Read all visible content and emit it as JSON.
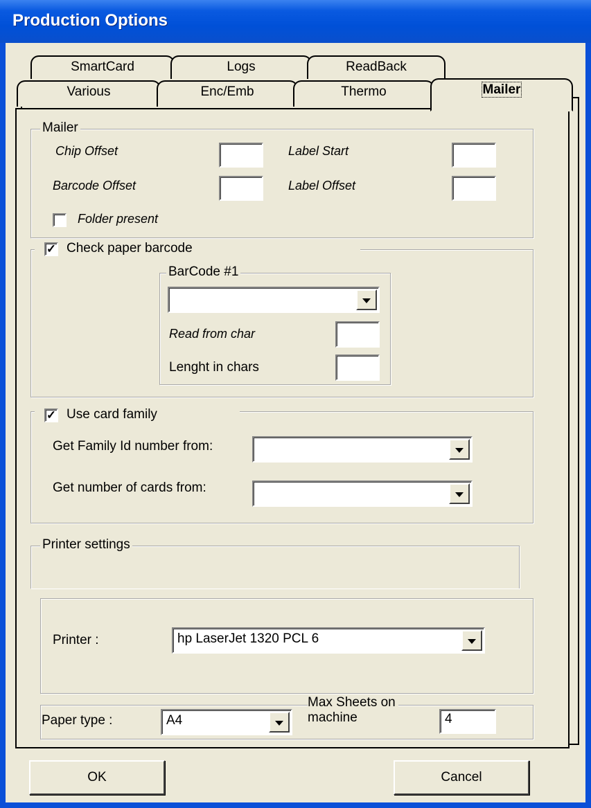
{
  "window": {
    "title": "Production Options"
  },
  "tabs": {
    "row_back": [
      "SmartCard",
      "Logs",
      "ReadBack"
    ],
    "row_front": [
      "Various",
      "Enc/Emb",
      "Thermo",
      "Mailer"
    ],
    "active": "Mailer"
  },
  "mailer": {
    "legend": "Mailer",
    "chip_offset": {
      "label": "Chip Offset",
      "value": ""
    },
    "label_start": {
      "label": "Label Start",
      "value": ""
    },
    "barcode_offset": {
      "label": "Barcode Offset",
      "value": ""
    },
    "label_offset": {
      "label": "Label Offset",
      "value": ""
    },
    "folder_present": {
      "label": "Folder present",
      "checked": false
    }
  },
  "check_barcode": {
    "label": "Check paper barcode",
    "checked": true,
    "barcode1": {
      "legend": "BarCode #1",
      "selected": "",
      "read_from_char": {
        "label": "Read from char",
        "value": ""
      },
      "length_in_chars": {
        "label": "Lenght in chars",
        "value": ""
      }
    }
  },
  "card_family": {
    "label": "Use card family",
    "checked": true,
    "family_id": {
      "label": "Get Family Id number from:",
      "selected": ""
    },
    "num_cards": {
      "label": "Get number of cards from:",
      "selected": ""
    }
  },
  "printer_settings": {
    "legend": "Printer settings",
    "printer": {
      "label": "Printer :",
      "selected": "hp LaserJet 1320 PCL 6"
    },
    "paper_type": {
      "label": "Paper type :",
      "selected": "A4"
    },
    "max_sheets": {
      "label_line1": "Max Sheets on",
      "label_line2": "machine",
      "value": "4"
    }
  },
  "buttons": {
    "ok": "OK",
    "cancel": "Cancel"
  }
}
